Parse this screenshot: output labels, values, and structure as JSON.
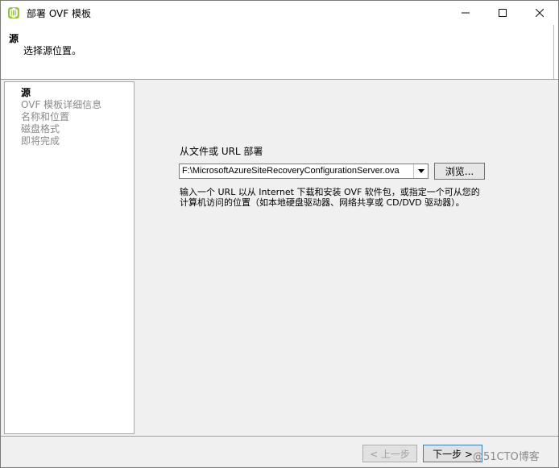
{
  "window": {
    "title": "部署 OVF 模板",
    "controls": {
      "minimize": "—",
      "maximize": "☐",
      "close": "✕"
    }
  },
  "header": {
    "title": "源",
    "subtitle": "选择源位置。"
  },
  "steps": [
    {
      "label": "源",
      "active": true
    },
    {
      "label": "OVF 模板详细信息",
      "active": false
    },
    {
      "label": "名称和位置",
      "active": false
    },
    {
      "label": "磁盘格式",
      "active": false
    },
    {
      "label": "即将完成",
      "active": false
    }
  ],
  "main": {
    "source_label": "从文件或 URL 部署",
    "source_value": "F:\\MicrosoftAzureSiteRecoveryConfigurationServer.ova",
    "browse_label": "浏览...",
    "help_line1": "输入一个 URL 以从 Internet 下载和安装 OVF 软件包，或指定一个可从您的",
    "help_line2": "计算机访问的位置（如本地硬盘驱动器、网络共享或 CD/DVD 驱动器）。"
  },
  "footer": {
    "back_label": "< 上一步",
    "next_label": "下一步 >",
    "watermark": "@51CTO博客"
  },
  "colors": {
    "app_icon": "#9fc33c",
    "disabled_text": "#a0a0a0",
    "default_button_border": "#3c7fb1"
  },
  "icons": {
    "app": "vsphere-green-icon",
    "combo_arrow": "chevron-down-icon"
  }
}
